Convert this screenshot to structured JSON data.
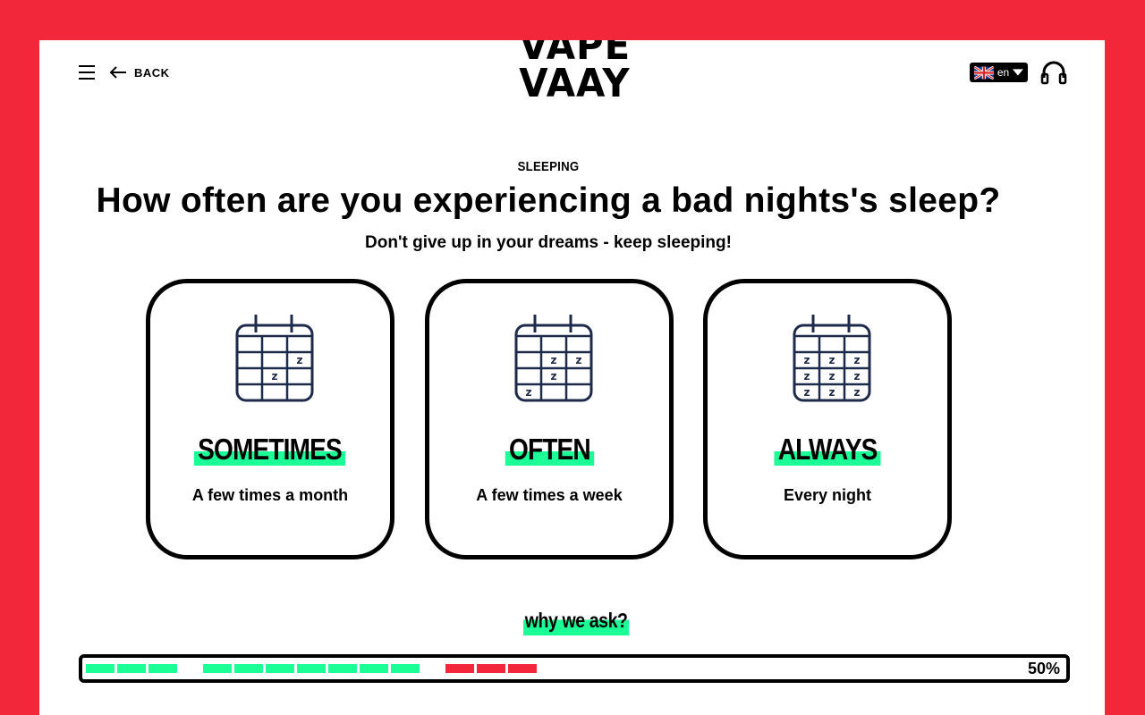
{
  "header": {
    "back_label": "BACK",
    "logo_line1": "VAPE",
    "logo_line2": "VAAY",
    "language": "en"
  },
  "quiz": {
    "category": "SLEEPING",
    "question": "How often are you experiencing a bad nights's sleep?",
    "subtitle": "Don't give up in your dreams - keep sleeping!",
    "options": [
      {
        "title": "SOMETIMES",
        "description": "A few times a month",
        "icon": "calendar-few-z-icon"
      },
      {
        "title": "OFTEN",
        "description": "A few times a week",
        "icon": "calendar-some-z-icon"
      },
      {
        "title": "ALWAYS",
        "description": "Every night",
        "icon": "calendar-full-z-icon"
      }
    ],
    "why_label": "why we ask?"
  },
  "progress": {
    "label": "50%",
    "value": 0.5,
    "segments_complete": 10,
    "segments_current": 3
  },
  "colors": {
    "background": "#f2283a",
    "accent": "#1cff96",
    "icon": "#1e2a4a"
  }
}
